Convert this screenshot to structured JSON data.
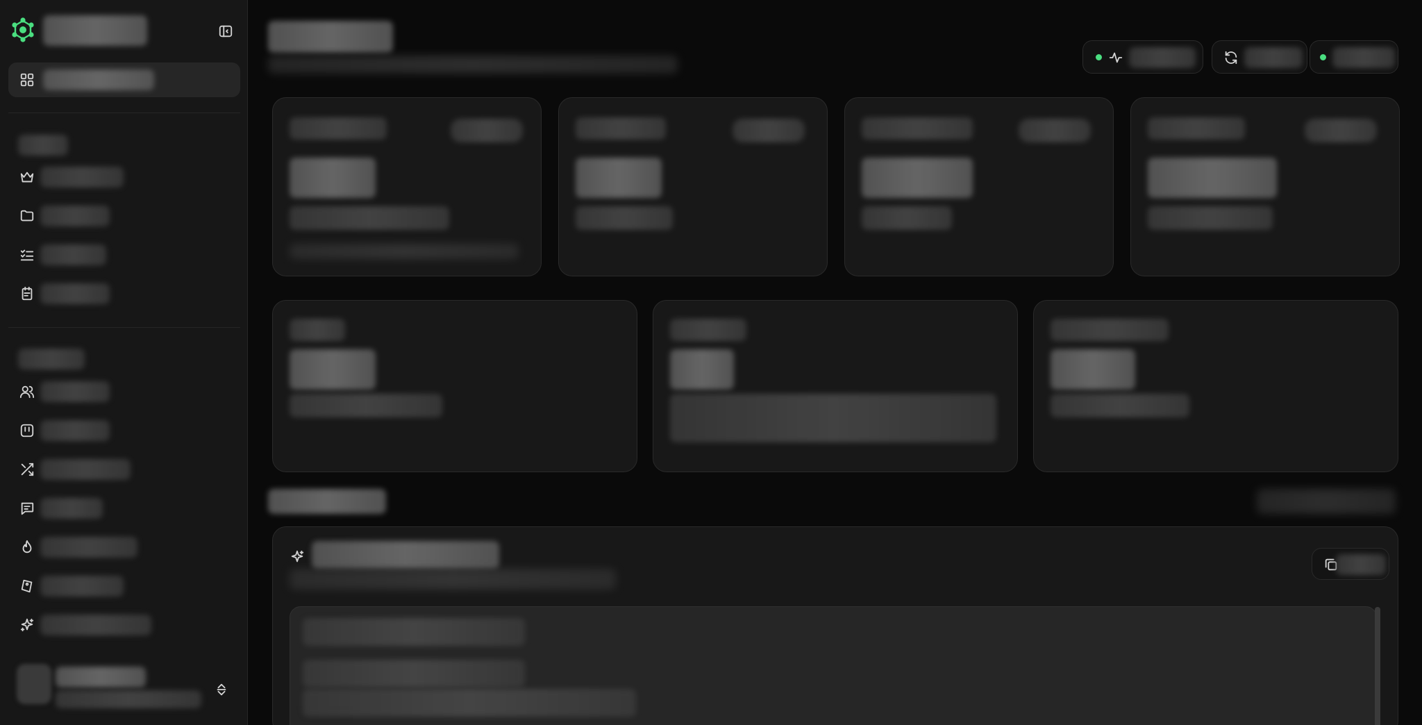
{
  "sidebar": {
    "brand": {
      "name": "",
      "logo_icon": "atom-logo-icon",
      "accent": "#4ade80"
    },
    "toggle_icon": "sidebar-toggle-icon",
    "active_item": {
      "label": "",
      "icon": "grid-icon"
    },
    "section_one": {
      "title": "",
      "items": [
        {
          "label": "",
          "icon": "crown-icon"
        },
        {
          "label": "",
          "icon": "folder-icon"
        },
        {
          "label": "",
          "icon": "list-check-icon"
        },
        {
          "label": "",
          "icon": "clipboard-icon"
        }
      ]
    },
    "section_two": {
      "title": "",
      "items": [
        {
          "label": "",
          "icon": "users-icon"
        },
        {
          "label": "",
          "icon": "app-square-icon"
        },
        {
          "label": "",
          "icon": "shuffle-icon"
        },
        {
          "label": "",
          "icon": "message-square-icon"
        },
        {
          "label": "",
          "icon": "flame-icon"
        },
        {
          "label": "",
          "icon": "tag-icon"
        },
        {
          "label": "",
          "icon": "sparkles-icon"
        }
      ]
    },
    "user": {
      "name": "",
      "email": "",
      "switch_icon": "chevrons-up-down-icon"
    }
  },
  "header": {
    "title": "",
    "subtitle": "",
    "actions": [
      {
        "label": "",
        "icon": "activity-icon",
        "status_color": "#4ade80"
      },
      {
        "label": "",
        "icon": "refresh-icon"
      },
      {
        "label": "",
        "status_color": "#4ade80"
      }
    ]
  },
  "stats_row_one": [
    {
      "title": "",
      "badge": "",
      "value": "",
      "description": "",
      "footer": ""
    },
    {
      "title": "",
      "badge": "",
      "value": "",
      "description": ""
    },
    {
      "title": "",
      "badge": "",
      "value": "",
      "description": ""
    },
    {
      "title": "",
      "badge": "",
      "value": "",
      "description": ""
    }
  ],
  "stats_row_two": [
    {
      "title": "",
      "value": "",
      "description": ""
    },
    {
      "title": "",
      "value": "",
      "description": ""
    },
    {
      "title": "",
      "value": "",
      "description": ""
    }
  ],
  "section": {
    "title": "",
    "right_link": "",
    "card": {
      "title": "",
      "subtitle": "",
      "copy_label": "",
      "icons": {
        "title": "sparkles-icon",
        "copy": "copy-icon"
      },
      "lines": [
        "",
        "",
        ""
      ]
    }
  }
}
